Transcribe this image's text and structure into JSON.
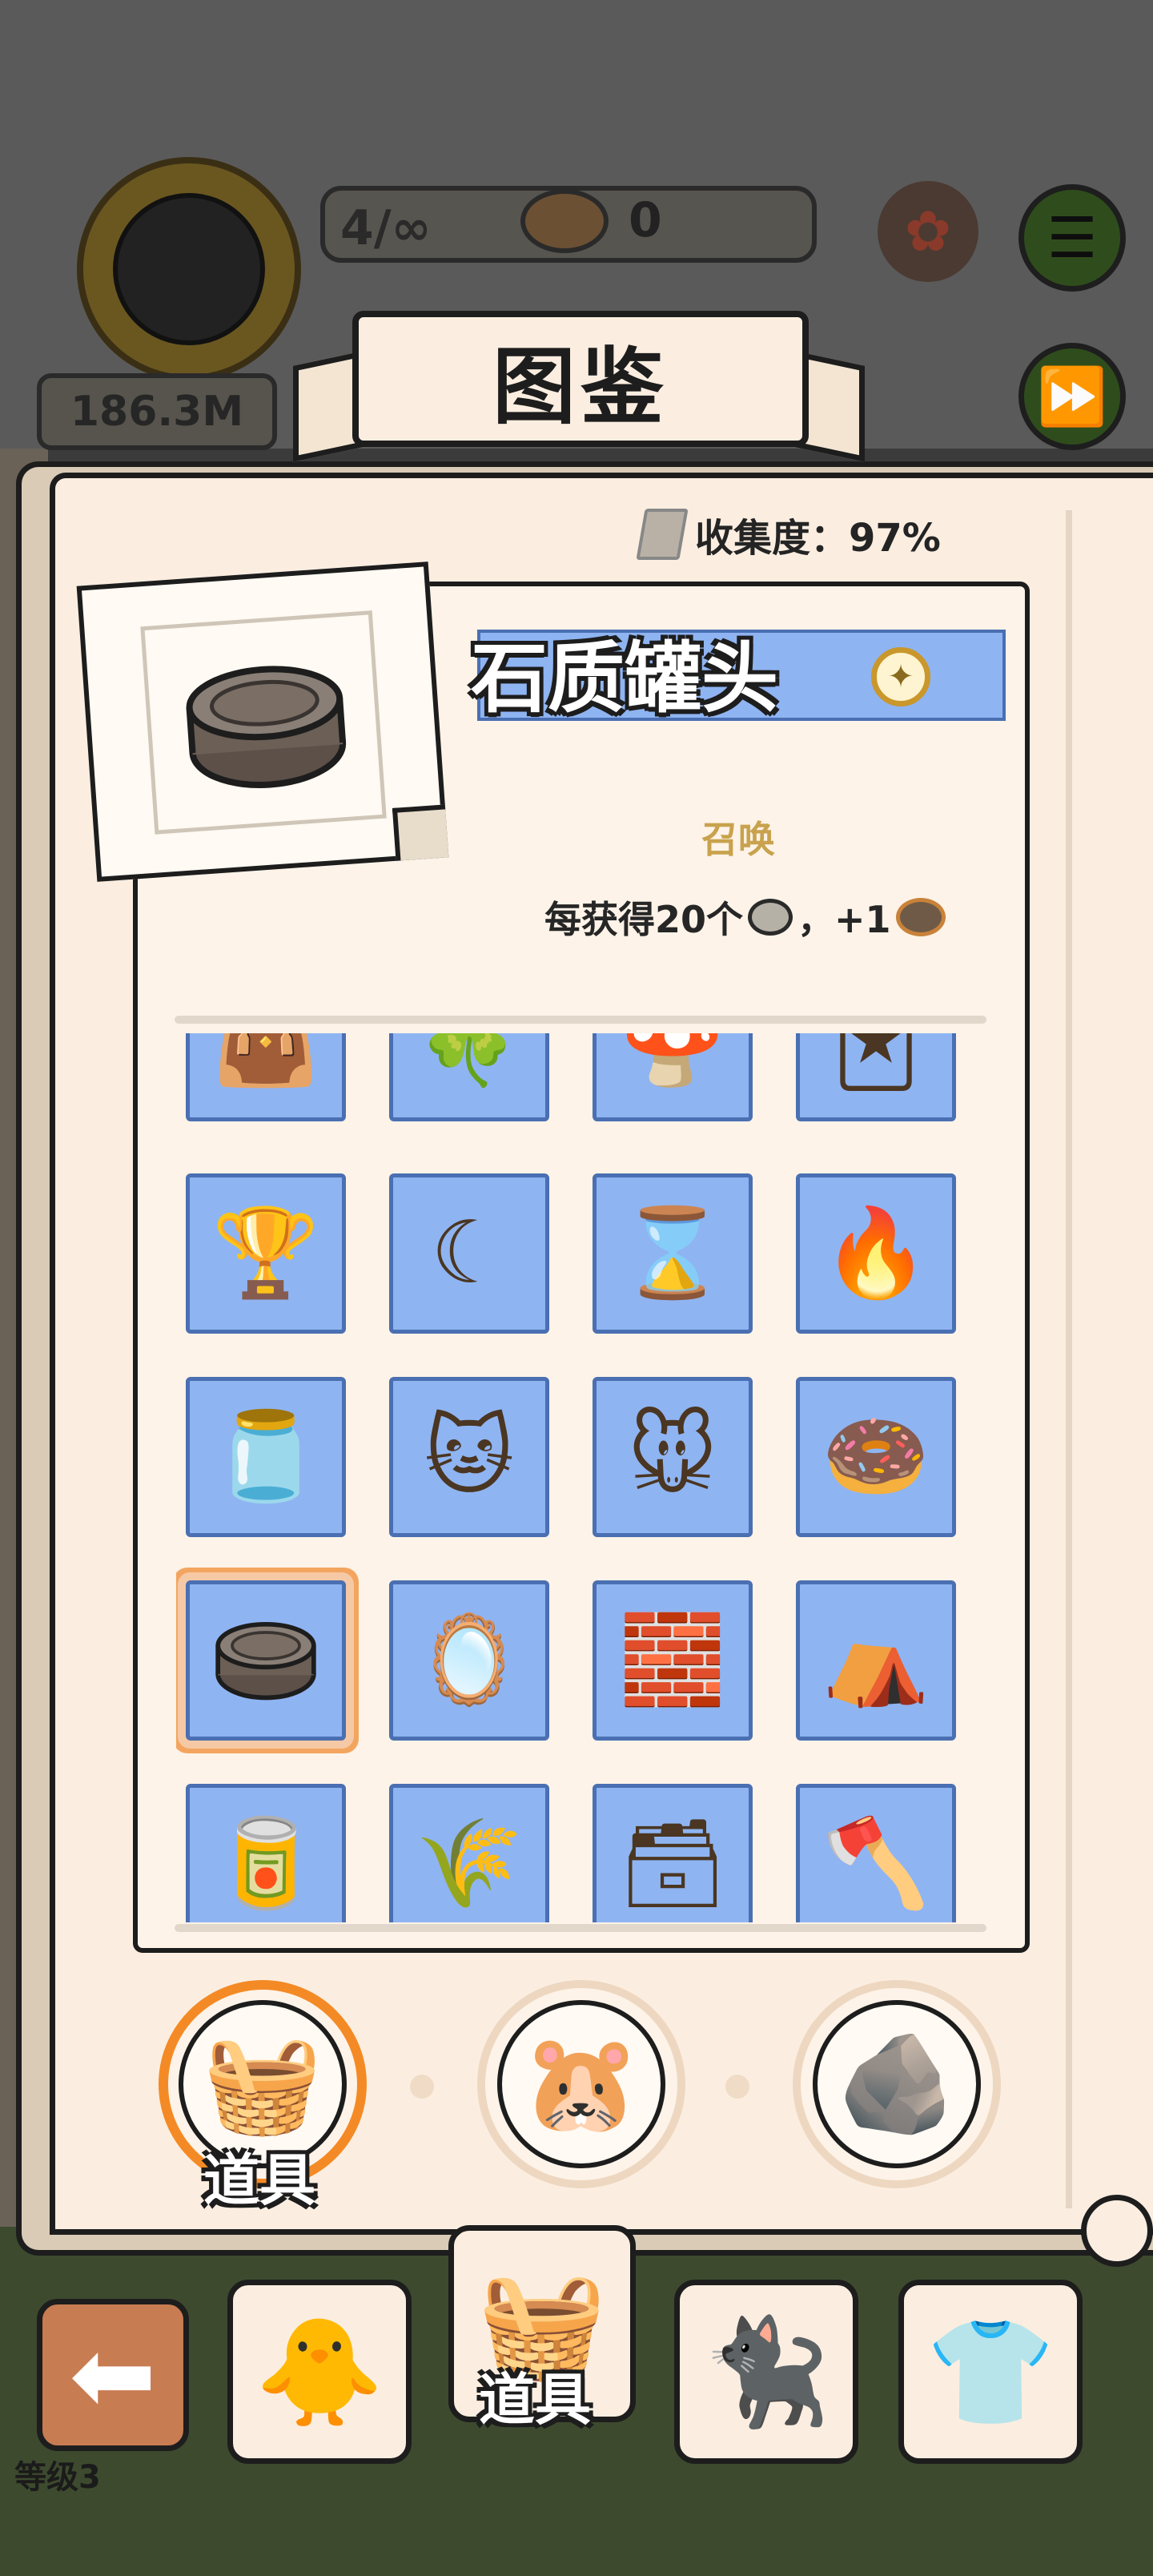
{
  "hud": {
    "level_counter": "4/∞",
    "coin_count": "0",
    "money": "186.3M"
  },
  "book": {
    "title": "图鉴",
    "collection_label": "收集度：97%"
  },
  "detail": {
    "item_name": "石质罐头",
    "source_label": "召唤",
    "effect_prefix": "每获得20个",
    "effect_suffix": "，+1"
  },
  "grid": {
    "rows": [
      [
        "tote-bag-icon",
        "clover-card-icon",
        "mushroom-can-icon",
        "flame-card-icon"
      ],
      [
        "trophy-icon",
        "scythe-icon",
        "hourglass-icon",
        "fire-plant-icon"
      ],
      [
        "ink-jar-icon",
        "cat-bag-icon",
        "wind-up-mouse-icon",
        "donut-icon"
      ],
      [
        "stone-can-icon",
        "mirror-icon",
        "stone-block-icon",
        "thatched-shelter-icon"
      ],
      [
        "leaf-can-icon",
        "grain-sack-icon",
        "wooden-press-icon",
        "axe-icon"
      ]
    ],
    "selected": "stone-can-icon"
  },
  "categories": {
    "items": [
      {
        "name": "category-tab-items",
        "icon": "picnic-basket-icon"
      },
      {
        "name": "category-tab-cats",
        "icon": "hamster-icon"
      },
      {
        "name": "category-tab-stones",
        "icon": "stones-icon"
      }
    ],
    "active_label": "道具"
  },
  "bottom_nav": {
    "active_label": "道具",
    "level_text": "等级3"
  },
  "colors": {
    "item_tile": "#8fb4f2",
    "selected_ring": "#f3a55f",
    "summon_gold": "#c8a24d",
    "hud_green": "#2f4d1c"
  }
}
